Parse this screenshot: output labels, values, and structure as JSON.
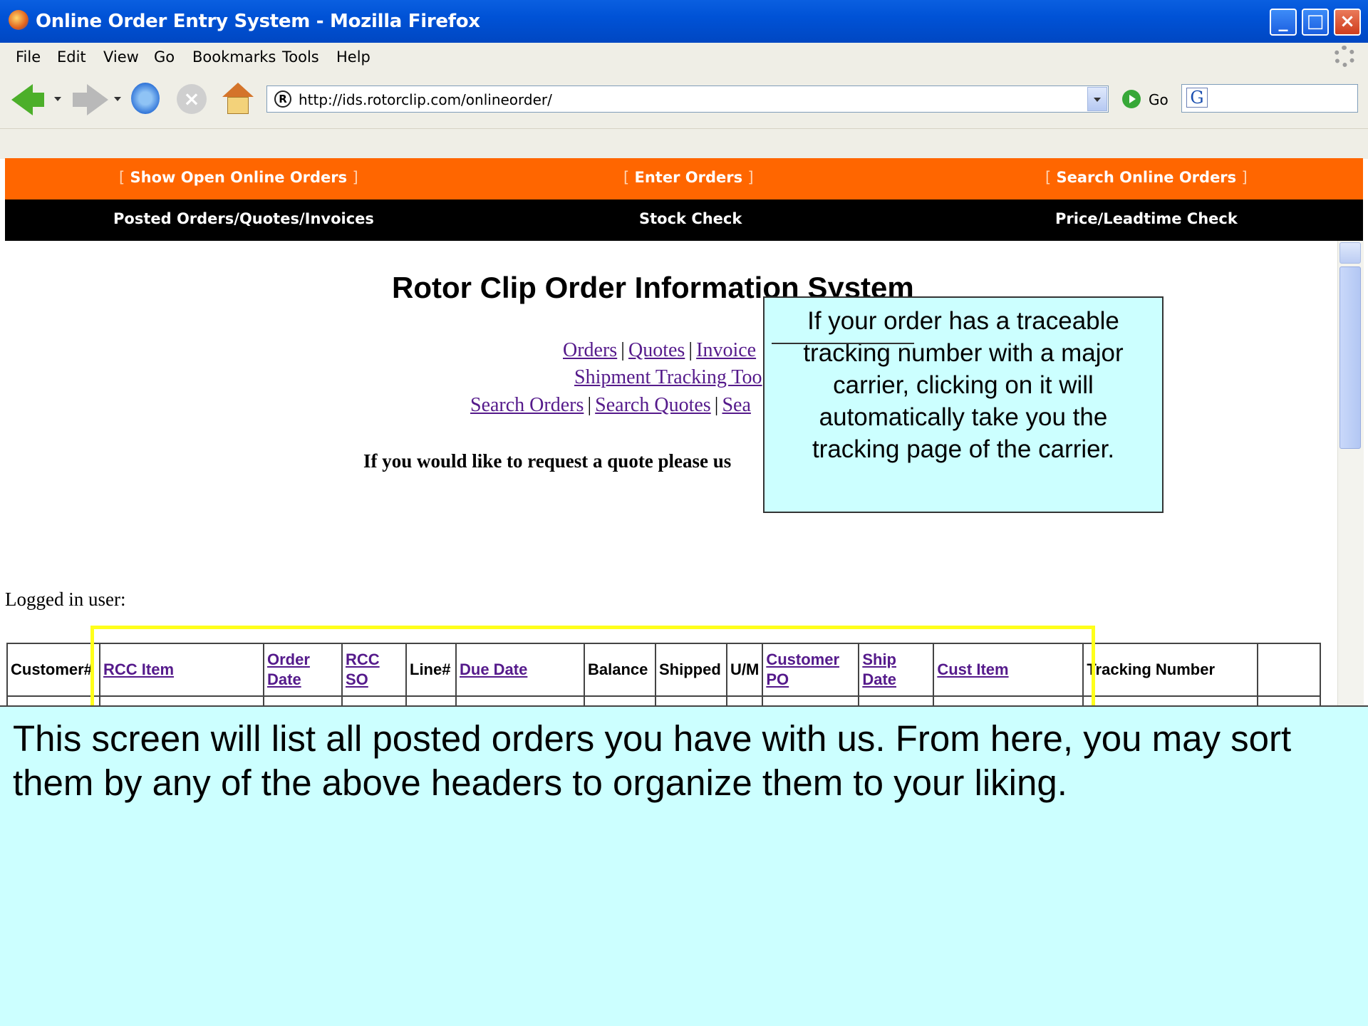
{
  "window": {
    "title": "Online Order Entry System - Mozilla Firefox",
    "buttons": [
      "minimize",
      "maximize",
      "close"
    ]
  },
  "menu": {
    "items": [
      "File",
      "Edit",
      "View",
      "Go",
      "Bookmarks",
      "Tools",
      "Help"
    ]
  },
  "toolbar": {
    "url": "http://ids.rotorclip.com/onlineorder/",
    "go_label": "Go",
    "search_engine_letter": "G"
  },
  "site_nav": {
    "top": [
      "Show Open Online Orders",
      "Enter Orders",
      "Search Online Orders"
    ],
    "bottom": [
      "Posted Orders/Quotes/Invoices",
      "Stock Check",
      "Price/Leadtime Check"
    ],
    "bracket_open": "[",
    "bracket_close": "]"
  },
  "page": {
    "heading": "Rotor Clip Order Information System",
    "links_row1": [
      "Orders",
      "Quotes",
      "Invoice"
    ],
    "links_row2": [
      "Shipment Tracking Too"
    ],
    "links_row3": [
      "Search Orders",
      "Search Quotes",
      "Sea"
    ],
    "separator": "|",
    "quote_note": "If you would like to request a quote please us",
    "logged_in_label": "Logged in user:"
  },
  "table": {
    "columns": [
      {
        "label": "Customer#",
        "sortable": false
      },
      {
        "label": "RCC Item",
        "sortable": true
      },
      {
        "label": "Order Date",
        "sortable": true
      },
      {
        "label": "RCC SO",
        "sortable": true
      },
      {
        "label": "Line#",
        "sortable": false
      },
      {
        "label": "Due Date",
        "sortable": true
      },
      {
        "label": "Balance",
        "sortable": false
      },
      {
        "label": "Shipped",
        "sortable": false
      },
      {
        "label": "U/M",
        "sortable": false
      },
      {
        "label": "Customer PO",
        "sortable": true
      },
      {
        "label": "Ship Date",
        "sortable": true
      },
      {
        "label": "Cust Item",
        "sortable": true
      },
      {
        "label": "Tracking Number",
        "sortable": false
      },
      {
        "label": "",
        "sortable": false
      }
    ]
  },
  "callout": {
    "text": "If your order has a traceable tracking number with a major carrier, clicking on it will automatically take you the tracking page of the carrier."
  },
  "caption": {
    "text": "This screen will list all posted orders you have with us.  From here, you may sort them by any of the above headers to organize them to your liking."
  },
  "colors": {
    "orange_bar": "#ff6600",
    "black_bar": "#000000",
    "callout_bg": "#ccffff",
    "highlight": "#ffff1a",
    "visited_link": "#551a8b"
  }
}
